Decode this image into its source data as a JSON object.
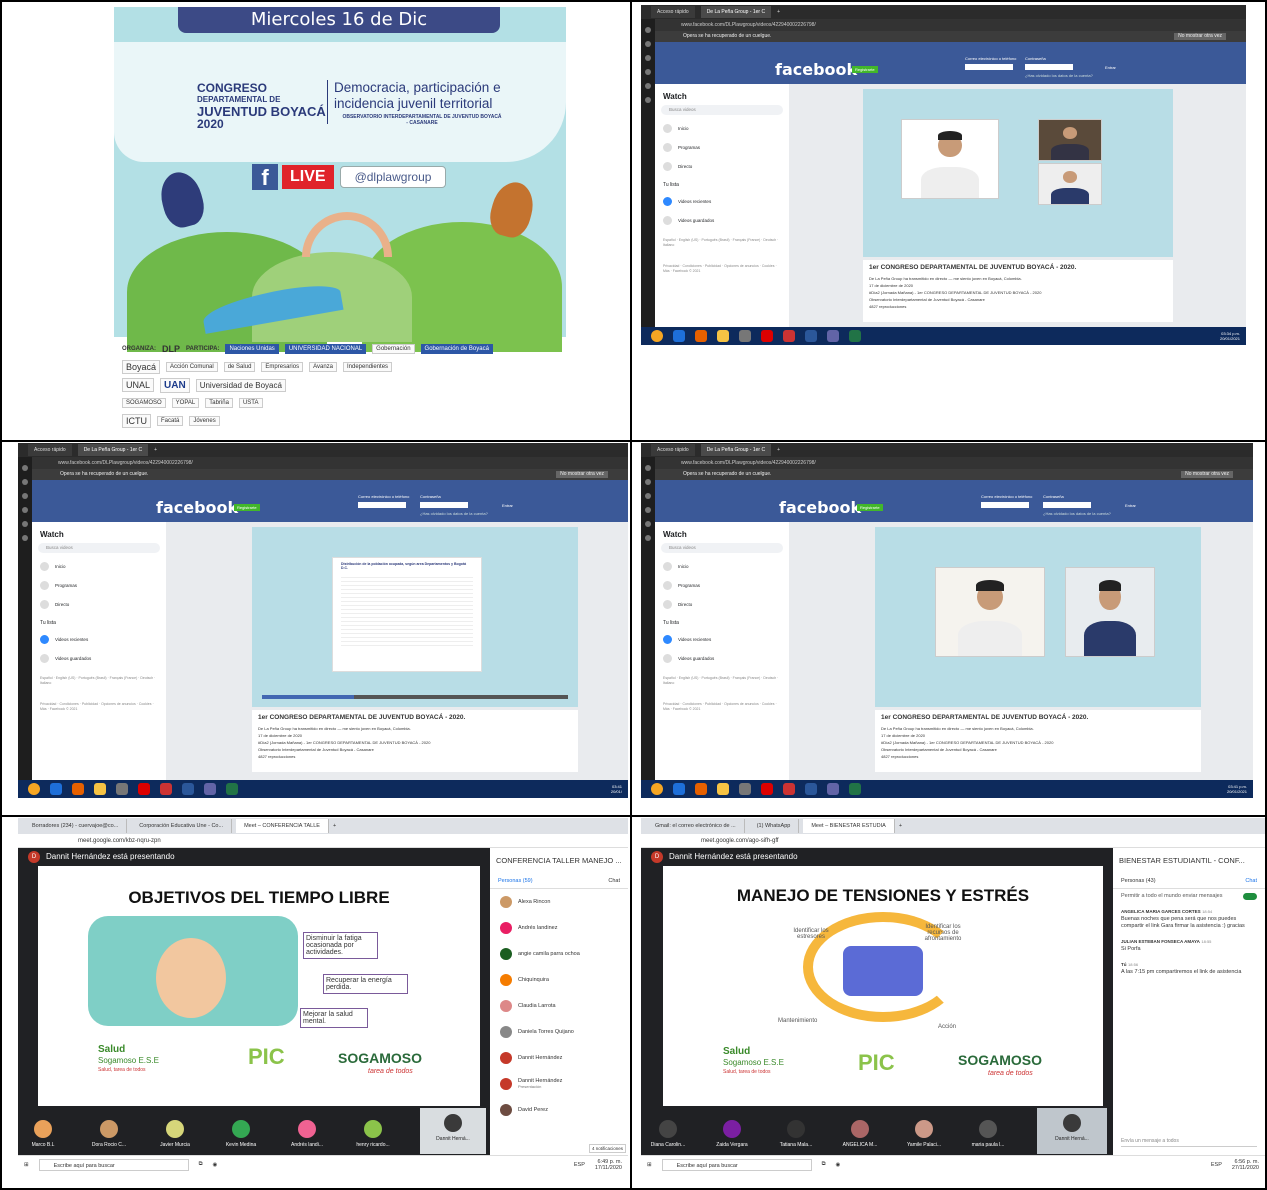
{
  "poster": {
    "date_banner": "Miercoles 16 de Dic",
    "logo_line1": "CONGRESO",
    "logo_line2": "DEPARTAMENTAL DE",
    "logo_line3": "JUVENTUD BOYACÁ",
    "logo_year": "2020",
    "title_line1": "Democracia, participación e",
    "title_line2": "incidencia juvenil territorial",
    "subtitle": "OBSERVATORIO INTERDEPARTAMENTAL DE JUVENTUD BOYACÁ - CASANARE",
    "live_label": "LIVE",
    "handle": "@dlplawgroup",
    "organiza_label": "ORGANIZA:",
    "dlp": "DLP",
    "participa_label": "PARTICIPA:",
    "sponsors_row1": [
      "Naciones Unidas",
      "UNIVERSIDAD NACIONAL",
      "Gobernación",
      "Gobernación de Boyacá"
    ],
    "sponsors_row2": [
      "Boyacá",
      "Acción Comunal",
      "de Salud",
      "Empresarios",
      "Avanza",
      "Independientes"
    ],
    "sponsors_row3": [
      "UNAL",
      "UAN",
      "Universidad de Boyacá"
    ],
    "sponsors_row4": [
      "SOGAMOSO",
      "YOPAL",
      "Tabriña",
      "USTA"
    ],
    "sponsors_row5": [
      "ICTU",
      "Facatá",
      "Jóvenes"
    ]
  },
  "fb_common": {
    "tab1": "Acceso rápido",
    "tab2": "De La Peña Group - 1er C",
    "url": "www.facebook.com/DLPlawgroup/videos/422940002226798/",
    "recovered_msg": "Opera se ha recuperado de un cuelgue.",
    "no_show": "No mostrar otra vez",
    "logo": "facebook",
    "register": "Registrarte",
    "email_label": "Correo electrónico o teléfono",
    "password_label": "Contraseña",
    "login_btn": "Entrar",
    "forgot": "¿Has olvidado los datos de la cuenta?",
    "watch_title": "Watch",
    "search_placeholder": "Busca videos",
    "nav_items": [
      "Inicio",
      "Programas",
      "Directo"
    ],
    "your_list": "Tu lista",
    "list_items": [
      "Videos recientes",
      "Videos guardados"
    ],
    "lang_text": "Español · English (US) · Português (Brasil) · Français (France) · Deutsch · Italiano",
    "footer_text": "Privacidad · Condiciones · Publicidad · Opciones de anuncios · Cookies · Más · Facebook © 2021",
    "video_title": "1er CONGRESO DEPARTAMENTAL DE JUVENTUD BOYACÁ - 2020.",
    "post_line": "De La Peña Group ha transmitido en directo — me siento joven en Boyacá, Colombia.",
    "post_date": "17 de diciembre de 2020",
    "hashtag_line": "#Día2 (Jornada Mañana) - 1er CONGRESO DEPARTAMENTAL DE JUVENTUD BOYACÁ - 2020",
    "observatorio": "Observatorio Interdepartamental de Juventud Boyacá - Casanare",
    "views": "4827 reproducciones",
    "slide_chart_title": "Distribución de la población ocupada, según area Departamentos y Bogotá D.C."
  },
  "fb_clocks": {
    "c1_time": "03:34 p.m.",
    "c1_date": "20/01/2021",
    "c2_time": "03:41",
    "c2_date": "20/01/",
    "c3_time": "03:41 p.m.",
    "c3_date": "20/01/2021"
  },
  "meet_left": {
    "tab1": "Borradores (234) - cuervajoe@co...",
    "tab2": "Corporación Educativa Une - Co...",
    "tab3": "Meet – CONFERENCIA TALLE",
    "url": "meet.google.com/kbz-nqru-zpn",
    "presenting": "Dannit Hernández está presentando",
    "slide_title": "OBJETIVOS DEL TIEMPO LIBRE",
    "box1": "Disminuir la fatiga ocasionada por actividades.",
    "box2": "Recuperar la energía perdida.",
    "box3": "Mejorar la salud mental.",
    "brand1": "Salud",
    "brand2": "Sogamoso E.S.E",
    "brand3": "Salud, tarea de todos",
    "pic": "PIC",
    "soga": "SOGAMOSO",
    "soga_tag": "tarea de todos",
    "panel_title": "CONFERENCIA TALLER MANEJO ...",
    "people_tab": "Personas (59)",
    "chat_tab": "Chat",
    "people": [
      "Alexa Rincon",
      "Andrés landinez",
      "angie camila parra ochoa",
      "Chiquinquira",
      "Claudia Larrota",
      "Daniela Torres Quijano",
      "Dannit Hernández",
      "Dannit Hernández",
      "David Perez"
    ],
    "presenting_sub": "Presentación",
    "tiles": [
      "Marco B.L",
      "Dora Rocio C...",
      "Javier Murcia",
      "Kevin Medina",
      "Andrés landi...",
      "henry ricardo...",
      "Dannit Herná..."
    ],
    "notif": "4 notificaciones",
    "search_taskbar": "Escribe aquí para buscar",
    "lang": "ESP",
    "time": "6:49 p. m.",
    "date": "17/11/2020"
  },
  "meet_right": {
    "tab1": "Gmail: el correo electrónico de ...",
    "tab2": "(1) WhatsApp",
    "tab3": "Meet – BIENESTAR ESTUDIA",
    "url": "meet.google.com/ago-sifh-gff",
    "presenting": "Dannit Hernández está presentando",
    "slide_title": "MANEJO DE TENSIONES Y ESTRÉS",
    "step1": "Identificar los estresores",
    "step2": "Identificar los recursos de afrontamiento",
    "step3": "Acción",
    "step4": "Mantenimiento",
    "panel_title": "BIENESTAR ESTUDIANTIL - CONF...",
    "people_tab": "Personas (43)",
    "chat_tab": "Chat",
    "allow_msg": "Permitir a todo el mundo enviar mensajes",
    "msg1_author": "ANGELICA MARIA GARCES CORTES",
    "msg1_time": "18:54",
    "msg1_text": "Buenas noches que pena será que nos puedes compartir el link Gara firmar la asistencia :) gracias",
    "msg2_author": "JULIAN ESTEBAN FONSECA AMAYA",
    "msg2_time": "18:55",
    "msg2_text": "Si Porfa",
    "msg3_author": "Tú",
    "msg3_time": "18:56",
    "msg3_text": "A las 7:15 pm compartiremos el link de asistencia",
    "chat_input": "Envía un mensaje a todos",
    "tiles": [
      "Diana Carolin...",
      "Zaida Vergara",
      "Tatiana Mala...",
      "ANGELICA M...",
      "Yamile Palaci...",
      "maria paula l...",
      "Dannit Herná..."
    ],
    "search_taskbar": "Escribe aquí para buscar",
    "lang": "ESP",
    "time": "6:56 p. m.",
    "date": "27/11/2020"
  }
}
